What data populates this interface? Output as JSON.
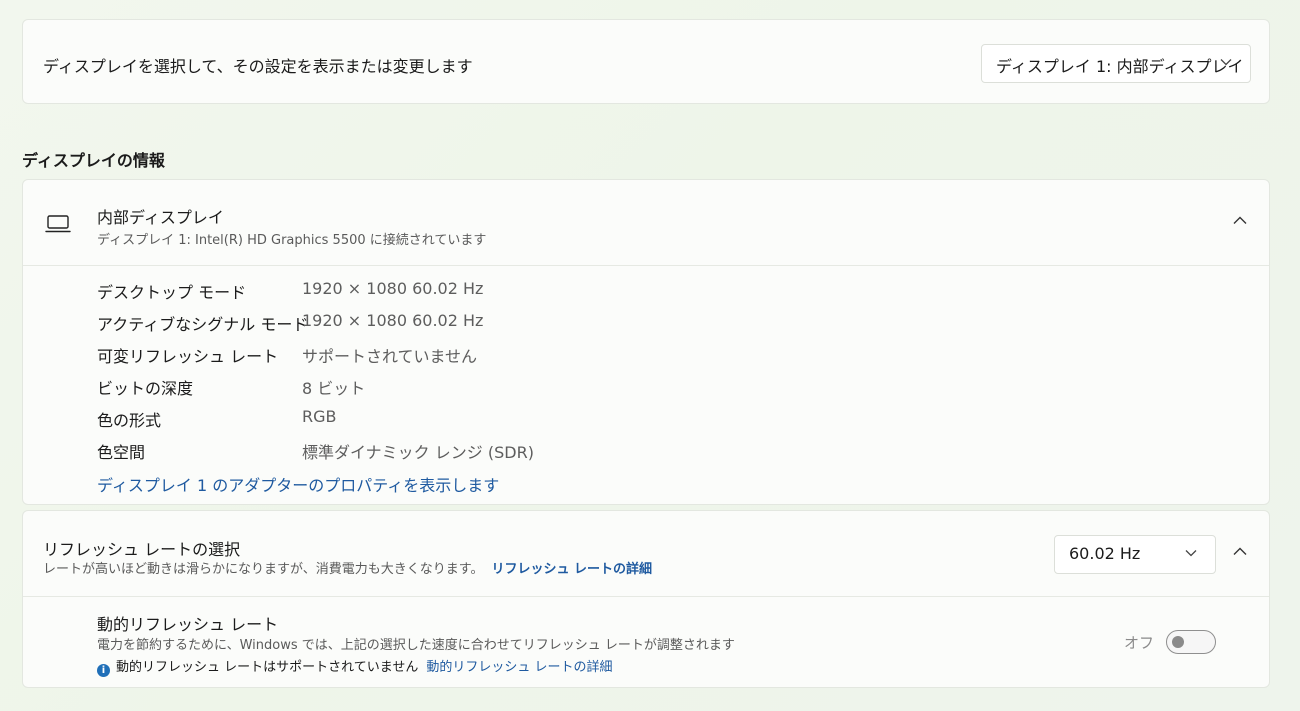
{
  "display_select": {
    "label": "ディスプレイを選択して、その設定を表示または変更します",
    "selected": "ディスプレイ 1: 内部ディスプレイ"
  },
  "section_heading": "ディスプレイの情報",
  "display_info": {
    "title": "内部ディスプレイ",
    "subtitle": "ディスプレイ 1: Intel(R) HD Graphics 5500 に接続されています",
    "rows": [
      {
        "key": "デスクトップ モード",
        "value": "1920 × 1080 60.02 Hz"
      },
      {
        "key": "アクティブなシグナル モード",
        "value": "1920 × 1080 60.02 Hz"
      },
      {
        "key": "可変リフレッシュ レート",
        "value": "サポートされていません"
      },
      {
        "key": "ビットの深度",
        "value": "8 ビット"
      },
      {
        "key": "色の形式",
        "value": "RGB"
      },
      {
        "key": "色空間",
        "value": "標準ダイナミック レンジ (SDR)"
      }
    ],
    "adapter_link": "ディスプレイ 1 のアダプターのプロパティを表示します"
  },
  "refresh": {
    "title": "リフレッシュ レートの選択",
    "subtitle": "レートが高いほど動きは滑らかになりますが、消費電力も大きくなります。",
    "details_link": "リフレッシュ レートの詳細",
    "selected_rate": "60.02 Hz",
    "dynamic": {
      "title": "動的リフレッシュ レート",
      "subtitle": "電力を節約するために、Windows では、上記の選択した速度に合わせてリフレッシュ レートが調整されます",
      "note": "動的リフレッシュ レートはサポートされていません",
      "note_link": "動的リフレッシュ レートの詳細",
      "toggle_label": "オフ",
      "toggle_on": false
    }
  },
  "colors": {
    "link": "#1f5aa0",
    "info_icon": "#1f6fb8"
  }
}
